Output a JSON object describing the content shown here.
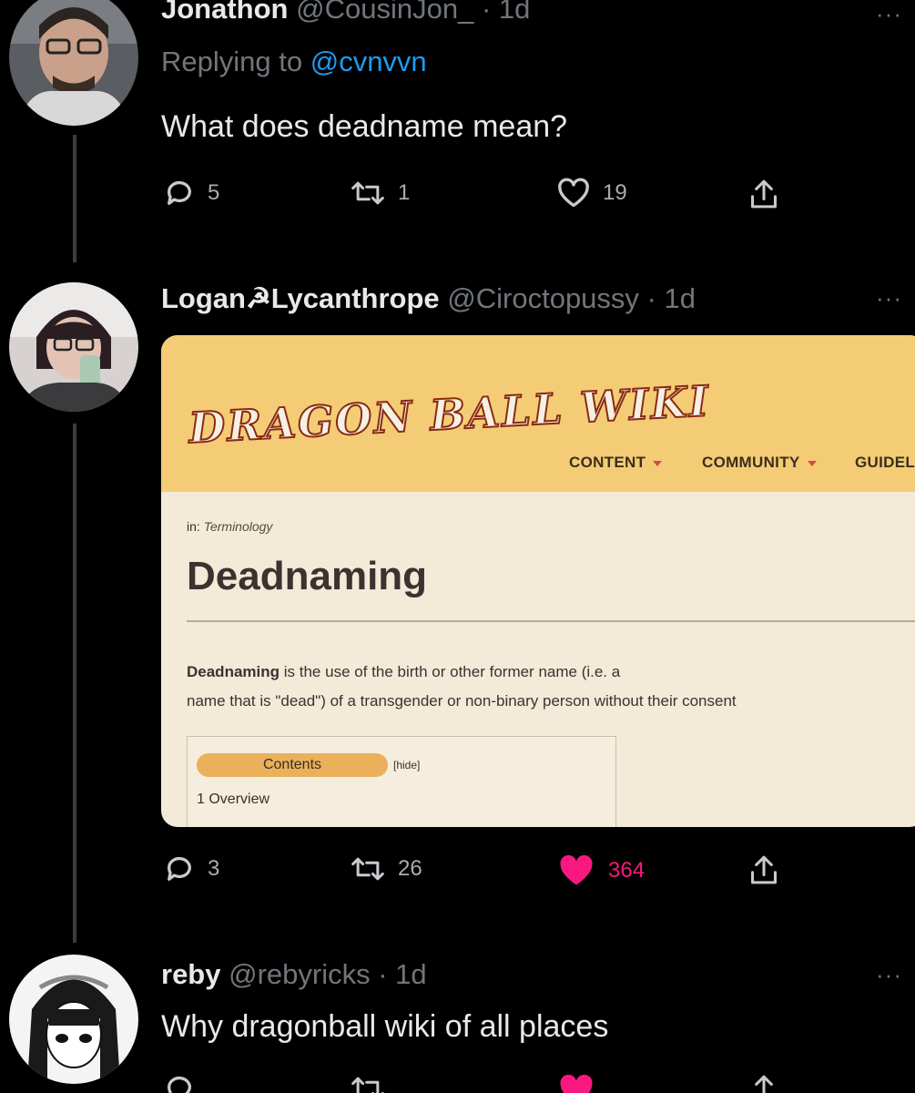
{
  "tweets": [
    {
      "name": "Jonathon",
      "handle": "@CousinJon_",
      "time": "· 1d",
      "replying_prefix": "Replying to",
      "replying_handle": "@cvnvvn",
      "text": "What does deadname mean?",
      "reply_count": "5",
      "retweet_count": "1",
      "like_count": "19",
      "more": "···"
    },
    {
      "name": "Logan☭Lycanthrope",
      "handle": "@Ciroctopussy",
      "time": "· 1d",
      "reply_count": "3",
      "retweet_count": "26",
      "like_count": "364",
      "liked": true,
      "more": "···"
    },
    {
      "name": "reby",
      "handle": "@rebyricks",
      "time": "· 1d",
      "text": "Why dragonball wiki of all places",
      "more": "···"
    }
  ],
  "wiki_card": {
    "logo": "DRAGON BALL WIKI",
    "nav": [
      "CONTENT",
      "COMMUNITY",
      "GUIDEL"
    ],
    "breadcrumb_prefix": "in:",
    "breadcrumb_category": "Terminology",
    "title": "Deadnaming",
    "intro_bold": "Deadnaming",
    "intro_line1_rest": " is the use of the birth or other former name (i.e. a",
    "intro_line2": "name that is \"dead\") of a transgender or non-binary person without their consent",
    "toc_title": "Contents",
    "toc_hide": "[hide]",
    "toc_item": "1 Overview"
  },
  "colors": {
    "background": "#000000",
    "link_blue": "#1d9bf0",
    "like_pink": "#f91880",
    "wiki_header": "#f4cc76",
    "wiki_body": "#f3ead8"
  }
}
